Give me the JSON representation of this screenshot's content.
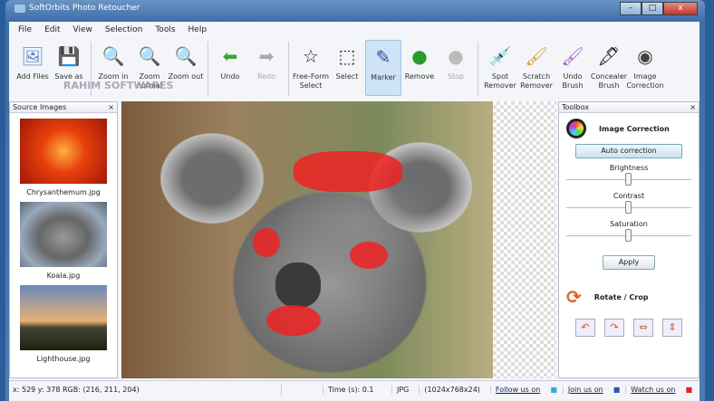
{
  "window": {
    "title": "SoftOrbits Photo Retoucher",
    "min": "–",
    "max": "□",
    "close": "x"
  },
  "menu": [
    "File",
    "Edit",
    "View",
    "Selection",
    "Tools",
    "Help"
  ],
  "toolbar": [
    {
      "label": "Add Files",
      "icon": "add-files-icon",
      "glyph": "🖼"
    },
    {
      "label": "Save as",
      "icon": "save-icon",
      "glyph": "💾"
    },
    {
      "label": "Zoom in",
      "icon": "zoom-in-icon",
      "glyph": "🔍"
    },
    {
      "label": "Zoom normal",
      "icon": "zoom-normal-icon",
      "glyph": "🔍"
    },
    {
      "label": "Zoom out",
      "icon": "zoom-out-icon",
      "glyph": "🔍"
    },
    {
      "label": "Undo",
      "icon": "undo-icon",
      "glyph": "⬅"
    },
    {
      "label": "Redo",
      "icon": "redo-icon",
      "glyph": "➡"
    },
    {
      "label": "Free-Form Select",
      "icon": "freeform-select-icon",
      "glyph": "☆"
    },
    {
      "label": "Select",
      "icon": "rect-select-icon",
      "glyph": "⬚"
    },
    {
      "label": "Marker",
      "icon": "marker-icon",
      "glyph": "✎"
    },
    {
      "label": "Remove",
      "icon": "remove-icon",
      "glyph": "●"
    },
    {
      "label": "Stop",
      "icon": "stop-icon",
      "glyph": "●"
    },
    {
      "label": "Spot Remover",
      "icon": "spot-remover-icon",
      "glyph": "💉"
    },
    {
      "label": "Scratch Remover",
      "icon": "scratch-remover-icon",
      "glyph": "🖌"
    },
    {
      "label": "Undo Brush",
      "icon": "undo-brush-icon",
      "glyph": "🖌"
    },
    {
      "label": "Concealer Brush",
      "icon": "concealer-brush-icon",
      "glyph": "🖋"
    },
    {
      "label": "Image Correction",
      "icon": "image-correction-icon",
      "glyph": "◉"
    }
  ],
  "watermark": "RAHIM SOFTWARES",
  "source_images": {
    "title": "Source Images",
    "items": [
      "Chrysanthemum.jpg",
      "Koala.jpg",
      "Lighthouse.jpg"
    ]
  },
  "toolbox": {
    "title": "Toolbox",
    "image_correction": "Image Correction",
    "auto": "Auto correction",
    "brightness": "Brightness",
    "contrast": "Contrast",
    "saturation": "Saturation",
    "levels": {
      "brightness": 0.5,
      "contrast": 0.5,
      "saturation": 0.5
    },
    "apply": "Apply",
    "rotate": "Rotate / Crop",
    "rotate_buttons": [
      "↶",
      "↷",
      "⇔",
      "⇕"
    ]
  },
  "status": {
    "coords": "x: 529 y: 378  RGB: (216, 211, 204)",
    "time": "Time (s): 0.1",
    "format": "JPG",
    "dims": "(1024x768x24)",
    "follow": "Follow us on",
    "join": "Join us on",
    "watch": "Watch us on"
  }
}
